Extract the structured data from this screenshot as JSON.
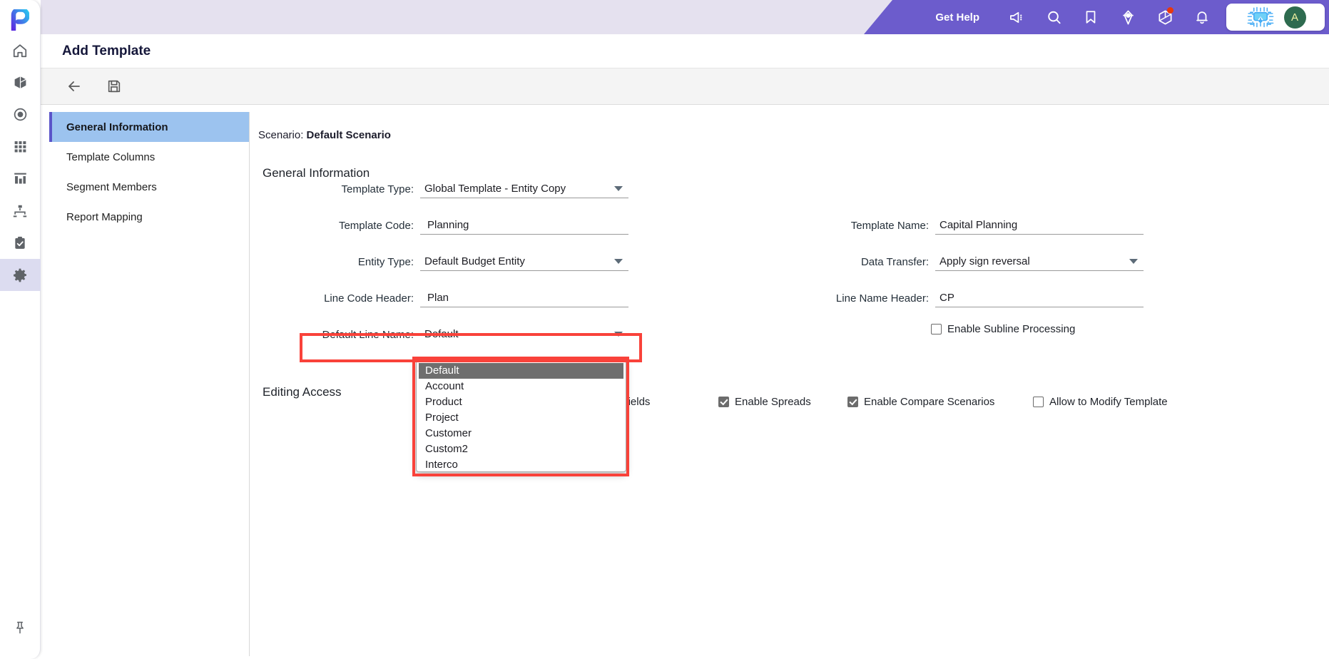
{
  "app": {
    "logo_icon": "p-logo-icon",
    "rail_items": [
      {
        "icon": "home-icon",
        "name": "home"
      },
      {
        "icon": "cube-icon",
        "name": "modeling"
      },
      {
        "icon": "target-icon",
        "name": "actuals"
      },
      {
        "icon": "grid-icon",
        "name": "apps"
      },
      {
        "icon": "bar-chart-icon",
        "name": "reports"
      },
      {
        "icon": "hierarchy-icon",
        "name": "workflow"
      },
      {
        "icon": "clipboard-check-icon",
        "name": "tasks"
      },
      {
        "icon": "gear-icon",
        "name": "settings"
      }
    ],
    "rail_active_index": 7,
    "pin_icon": "pin-icon"
  },
  "topbar": {
    "get_help": "Get Help",
    "icons": [
      {
        "name": "megaphone-icon",
        "badge": false
      },
      {
        "name": "search-icon",
        "badge": false
      },
      {
        "name": "bookmark-icon",
        "badge": false
      },
      {
        "name": "target-pin-icon",
        "badge": false
      },
      {
        "name": "cube-3d-icon",
        "badge": true
      },
      {
        "name": "bell-icon",
        "badge": false
      }
    ],
    "chip_icon": "microchip-ai-icon",
    "avatar_initial": "A",
    "purple": "#6c5ccc",
    "lavender": "#e5e1ef"
  },
  "header": {
    "page_title": "Add Template"
  },
  "toolbar": {
    "back_icon": "back-arrow-icon",
    "save_icon": "save-floppy-icon"
  },
  "sidepanel": {
    "items": [
      {
        "label": "General Information",
        "active": true
      },
      {
        "label": "Template Columns",
        "active": false
      },
      {
        "label": "Segment Members",
        "active": false
      },
      {
        "label": "Report Mapping",
        "active": false
      }
    ]
  },
  "main": {
    "scenario_label": "Scenario:",
    "scenario_value": "Default Scenario",
    "section_general": "General Information",
    "section_editing": "Editing Access",
    "fields": {
      "template_type": {
        "label": "Template Type:",
        "value": "Global Template - Entity Copy",
        "type": "select"
      },
      "template_code": {
        "label": "Template Code:",
        "value": "Planning",
        "type": "text"
      },
      "entity_type": {
        "label": "Entity Type:",
        "value": "Default Budget Entity",
        "type": "select"
      },
      "line_code_header": {
        "label": "Line Code Header:",
        "value": "Plan",
        "type": "text"
      },
      "default_line_name": {
        "label": "Default Line Name:",
        "value": "Default",
        "type": "select"
      },
      "template_name": {
        "label": "Template Name:",
        "value": "Capital Planning",
        "type": "text"
      },
      "data_transfer": {
        "label": "Data Transfer:",
        "value": "Apply sign reversal",
        "type": "select"
      },
      "line_name_header": {
        "label": "Line Name Header:",
        "value": "CP",
        "type": "text"
      }
    },
    "checkboxes": {
      "enable_subline_processing": {
        "label": "Enable Subline Processing",
        "checked": false
      },
      "enable_global_fields": {
        "label": "Enable Global Fields",
        "checked": true
      },
      "enable_spreads": {
        "label": "Enable Spreads",
        "checked": true
      },
      "enable_compare_scenarios": {
        "label": "Enable Compare Scenarios",
        "checked": true
      },
      "allow_to_modify_template": {
        "label": "Allow to Modify Template",
        "checked": false
      }
    }
  },
  "dropdown": {
    "open": true,
    "selected": "Default",
    "options": [
      "Default",
      "Account",
      "Product",
      "Project",
      "Customer",
      "Custom2",
      "Interco"
    ]
  },
  "highlight_color": "#f9423a"
}
